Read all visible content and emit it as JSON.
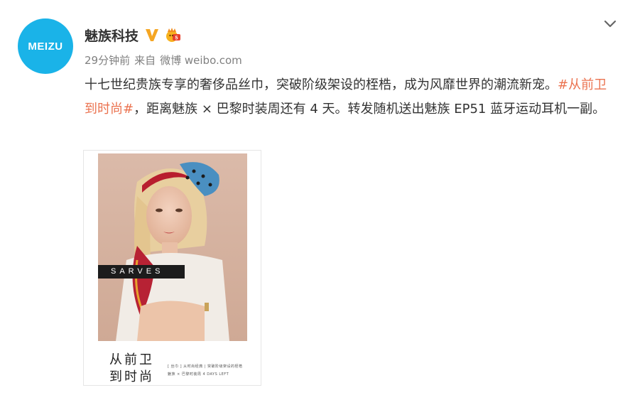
{
  "post": {
    "avatar_text": "MEIZU",
    "username": "魅族科技",
    "icons": {
      "verified": "verified-v-icon",
      "vip": "vip-badge-icon",
      "more": "chevron-down-icon"
    },
    "time": "29分钟前",
    "from_label": "来自",
    "source": "微博 weibo.com",
    "text_before": "十七世纪贵族专享的奢侈品丝巾，突破阶级架设的桎梏，成为风靡世界的潮流新宠。",
    "hashtag": "#从前卫到时尚#",
    "text_after": "，距离魅族 × 巴黎时装周还有 4 天。转发随机送出魅族 EP51 蓝牙运动耳机一副。",
    "colors": {
      "avatar_bg": "#1ab3e8",
      "hashtag": "#eb7350",
      "verified": "#f5a623"
    }
  },
  "image": {
    "banner": "SARVES",
    "caption_line1": "从前卫",
    "caption_line2": "到时尚",
    "small_line1": "[ 丝巾 ] 从时尚经典 | 突破阶级架设的桎梏",
    "small_line2": "魅族 × 巴黎时装周   4 DAYS LEFT"
  }
}
